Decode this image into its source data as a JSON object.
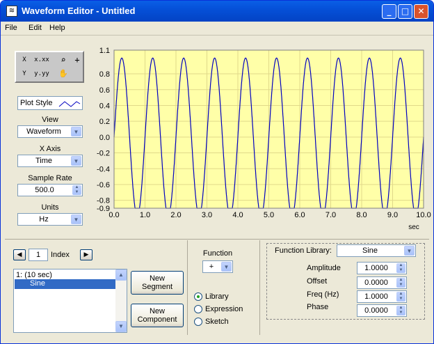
{
  "window": {
    "title": "Waveform Editor - Untitled",
    "controls": [
      "_",
      "□",
      "✕"
    ]
  },
  "menu": [
    "File",
    "Edit",
    "Help"
  ],
  "tools": {
    "cursor_x": "X",
    "cursor_y": "Y",
    "format_x": "x.xx",
    "format_y": "y.yy",
    "zoom": "zoom-icon",
    "crosshair": "+",
    "pan": "hand-icon"
  },
  "left_panel": {
    "plot_style_label": "Plot Style",
    "view_label": "View",
    "view_value": "Waveform",
    "xaxis_label": "X Axis",
    "xaxis_value": "Time",
    "sample_rate_label": "Sample Rate",
    "sample_rate_value": "500.0",
    "units_label": "Units",
    "units_value": "Hz"
  },
  "chart_data": {
    "type": "line",
    "xlabel": "sec",
    "ylabel": "",
    "xlim": [
      0,
      10
    ],
    "ylim": [
      -0.9,
      1.1
    ],
    "x_ticks": [
      "0.0",
      "1.0",
      "2.0",
      "3.0",
      "4.0",
      "5.0",
      "6.0",
      "7.0",
      "8.0",
      "9.0",
      "10.0"
    ],
    "y_ticks": [
      "1.1",
      "0.8",
      "0.6",
      "0.4",
      "0.2",
      "0.0",
      "-0.2",
      "-0.4",
      "-0.6",
      "-0.8",
      "-0.9"
    ],
    "y_tick_values": [
      1.1,
      0.8,
      0.6,
      0.4,
      0.2,
      0.0,
      -0.2,
      -0.4,
      -0.6,
      -0.8,
      -0.9
    ],
    "series": [
      {
        "function": "sine",
        "amplitude": 1.0,
        "offset": 0.0,
        "frequency": 1.0,
        "phase": 0.0,
        "color": "#0000c0"
      }
    ],
    "background": "#ffffa8",
    "grid": true
  },
  "bottom": {
    "index_value": "1",
    "index_label": "Index",
    "list_items": [
      "1:  (10 sec)",
      "Sine"
    ],
    "new_segment": [
      "New",
      "Segment"
    ],
    "new_component": [
      "New",
      "Component"
    ],
    "function_label": "Function",
    "function_value": "+",
    "radios": [
      "Library",
      "Expression",
      "Sketch"
    ],
    "selected_radio": "Library",
    "library_label": "Function Library:",
    "library_value": "Sine",
    "params": [
      {
        "label": "Amplitude",
        "value": "1.0000"
      },
      {
        "label": "Offset",
        "value": "0.0000"
      },
      {
        "label": "Freq (Hz)",
        "value": "1.0000"
      },
      {
        "label": "Phase",
        "value": "0.0000"
      }
    ]
  }
}
